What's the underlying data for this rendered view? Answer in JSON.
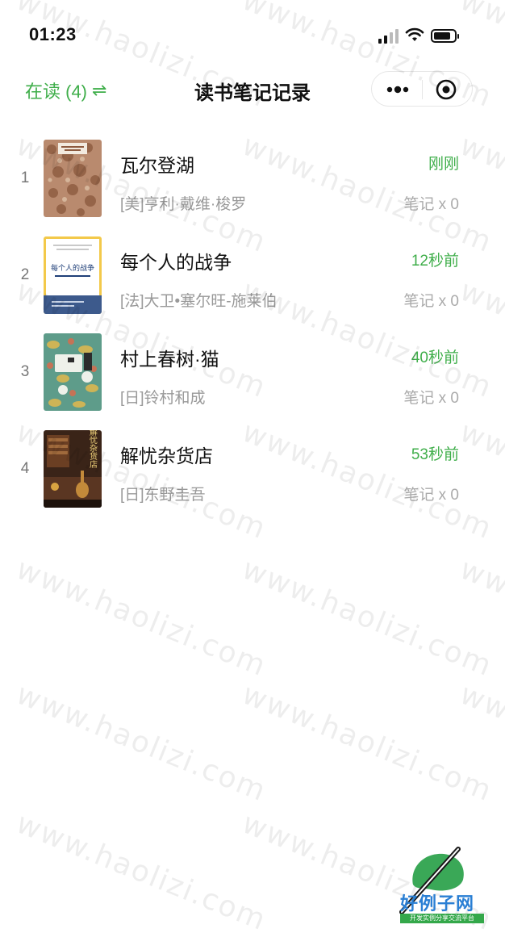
{
  "status_bar": {
    "time": "01:23"
  },
  "nav": {
    "filter_label": "在读 (4)",
    "filter_icon": "⇌",
    "title": "读书笔记记录"
  },
  "books": [
    {
      "rank": "1",
      "title": "瓦尔登湖",
      "author": "[美]亨利·戴维·梭罗",
      "time": "刚刚",
      "notes": "笔记 x 0"
    },
    {
      "rank": "2",
      "title": "每个人的战争",
      "author": "[法]大卫•塞尔旺-施莱伯",
      "time": "12秒前",
      "notes": "笔记 x 0"
    },
    {
      "rank": "3",
      "title": "村上春树·猫",
      "author": "[日]铃村和成",
      "time": "40秒前",
      "notes": "笔记 x 0"
    },
    {
      "rank": "4",
      "title": "解忧杂货店",
      "author": "[日]东野圭吾",
      "time": "53秒前",
      "notes": "笔记 x 0"
    }
  ],
  "covers": {
    "book2_title": "每个人的战争",
    "book4_title": "解忧杂货店"
  },
  "watermark": "www.haolizi.com",
  "site_badge": {
    "name": "好例子网",
    "tag": "开发实例分享交流平台"
  },
  "colors": {
    "accent": "#3fae4a",
    "muted": "#999999"
  }
}
